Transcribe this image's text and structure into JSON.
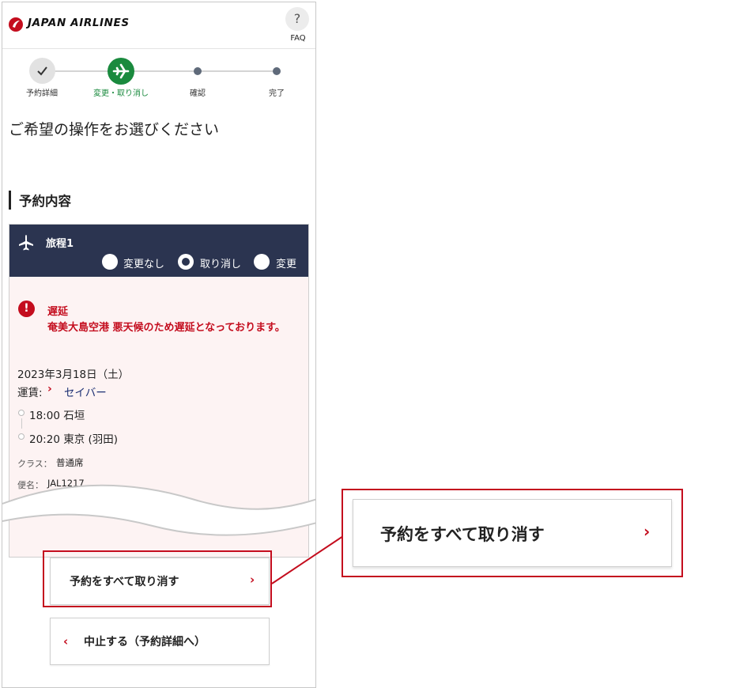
{
  "header": {
    "brand": "JAPAN AIRLINES",
    "faq_icon": "?",
    "faq_label": "FAQ"
  },
  "stepper": {
    "steps": [
      {
        "label": "予約詳細",
        "state": "done",
        "icon": "check-icon"
      },
      {
        "label": "変更・取り消し",
        "state": "current",
        "icon": "plane-icon"
      },
      {
        "label": "確認",
        "state": "upcoming"
      },
      {
        "label": "完了",
        "state": "upcoming"
      }
    ]
  },
  "instruction": "ご希望の操作をお選びください",
  "section_title": "予約内容",
  "itinerary": {
    "title": "旅程1",
    "options": [
      "変更なし",
      "取り消し",
      "変更"
    ],
    "selected": "取り消し",
    "alert": {
      "title": "遅延",
      "message": "奄美大島空港 悪天候のため遅延となっております。"
    },
    "date": "2023年3月18日（土）",
    "fare_label": "運賃:",
    "fare_value": "セイバー",
    "departure": "18:00 石垣",
    "arrival": "20:20 東京 (羽田)",
    "class_label": "クラス：",
    "class_value": "普通席",
    "flight_label": "便名：",
    "flight_value": "JAL1217"
  },
  "buttons": {
    "cancel_all": "予約をすべて取り消す",
    "cancel_all_chevron": "›",
    "abort": "中止する（予約詳細へ）",
    "abort_chevron": "‹"
  },
  "callout": {
    "label": "予約をすべて取り消す",
    "chevron": "›"
  },
  "colors": {
    "brand_red": "#c40d1e",
    "navy": "#2b3450",
    "step_green": "#1a8a3e",
    "alert_bg": "#fdf3f3"
  }
}
